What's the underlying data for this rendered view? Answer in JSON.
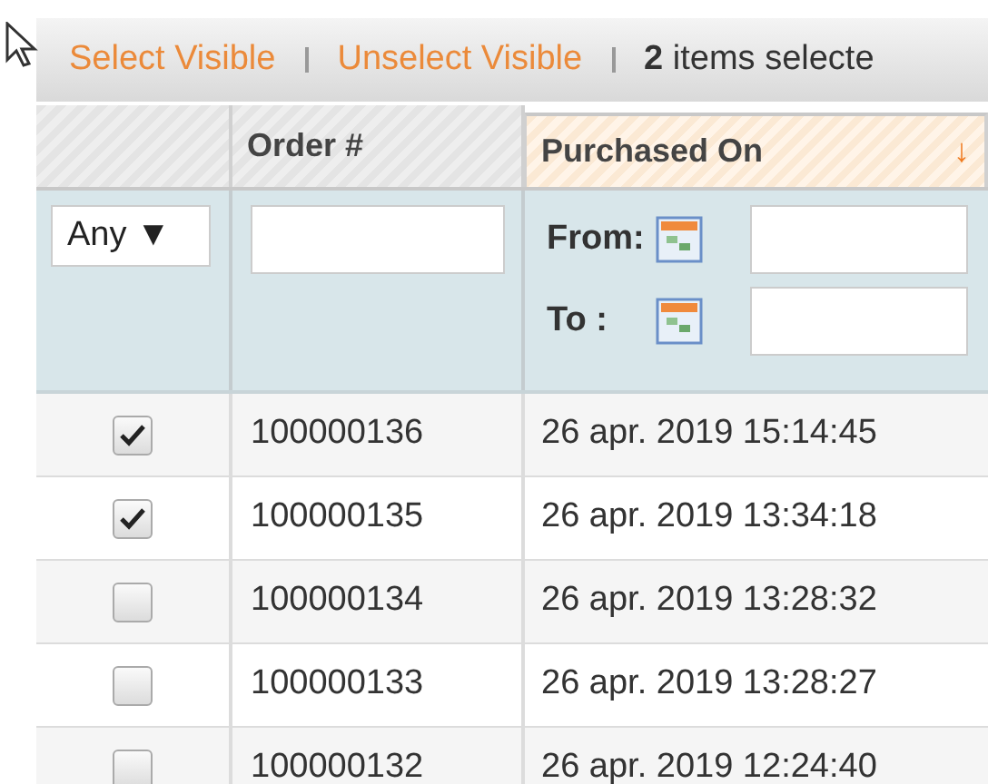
{
  "massaction": {
    "links": [
      "Select Visible",
      "Unselect Visible"
    ],
    "selected_count": "**2** items selecte"
  },
  "table": {
    "columns": [
      {
        "sorted": false
      },
      {
        "label": "Order #",
        "sorted": false
      },
      {
        "label": "Purchased On",
        "sorted": true,
        "sort_glyph": "↓"
      }
    ],
    "filters": {
      "select": "Any ▼",
      "from_label": "From:",
      "to_label": "To :"
    },
    "rows": [
      {
        "checked": true,
        "order": "100000136",
        "purchased_on": "26 apr. 2019 15:14:45"
      },
      {
        "checked": true,
        "order": "100000135",
        "purchased_on": "26 apr. 2019 13:34:18"
      },
      {
        "checked": false,
        "order": "100000134",
        "purchased_on": "26 apr. 2019 13:28:32"
      },
      {
        "checked": false,
        "order": "100000133",
        "purchased_on": "26 apr. 2019 13:28:27"
      },
      {
        "checked": false,
        "order": "100000132",
        "purchased_on": "26 apr. 2019 12:24:40"
      }
    ]
  }
}
